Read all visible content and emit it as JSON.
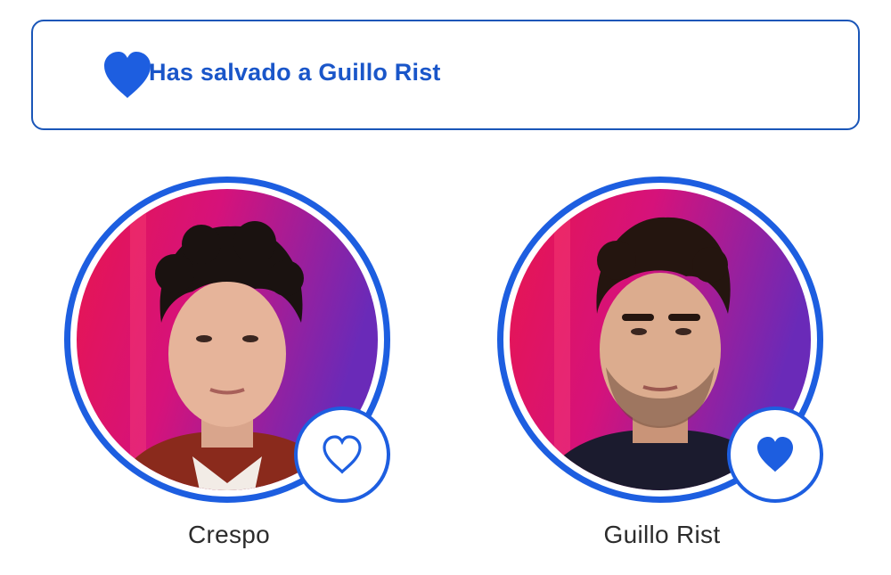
{
  "banner": {
    "text": "Has salvado a Guillo Rist",
    "icon": "heart-filled-icon",
    "color": "#1a56c9"
  },
  "contestants": [
    {
      "name": "Crespo",
      "saved": false,
      "vote_icon": "heart-outline-icon"
    },
    {
      "name": "Guillo Rist",
      "saved": true,
      "vote_icon": "heart-filled-icon"
    }
  ],
  "colors": {
    "accent": "#1d5ee0",
    "border": "#1a56b8",
    "text": "#2c2c2c"
  }
}
